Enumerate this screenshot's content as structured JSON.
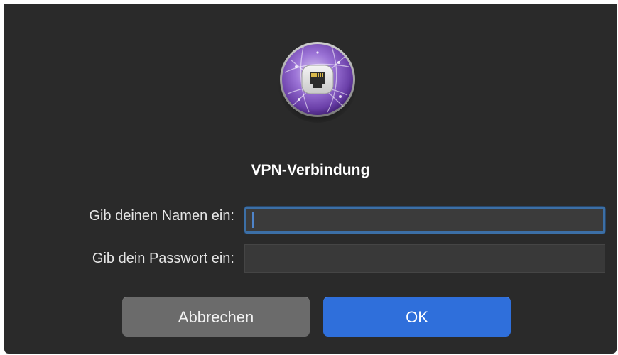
{
  "dialog": {
    "title": "VPN-Verbindung",
    "icon": "vpn-network-port-icon",
    "fields": {
      "name": {
        "label": "Gib deinen Namen ein:",
        "value": "",
        "placeholder": ""
      },
      "password": {
        "label": "Gib dein Passwort ein:",
        "value": "",
        "placeholder": ""
      }
    },
    "buttons": {
      "cancel": "Abbrechen",
      "ok": "OK"
    },
    "colors": {
      "background": "#2a2a2a",
      "accent": "#2f6fdb",
      "focus_ring": "#3c6fa6",
      "icon_purple": "#8a5fc7"
    }
  }
}
